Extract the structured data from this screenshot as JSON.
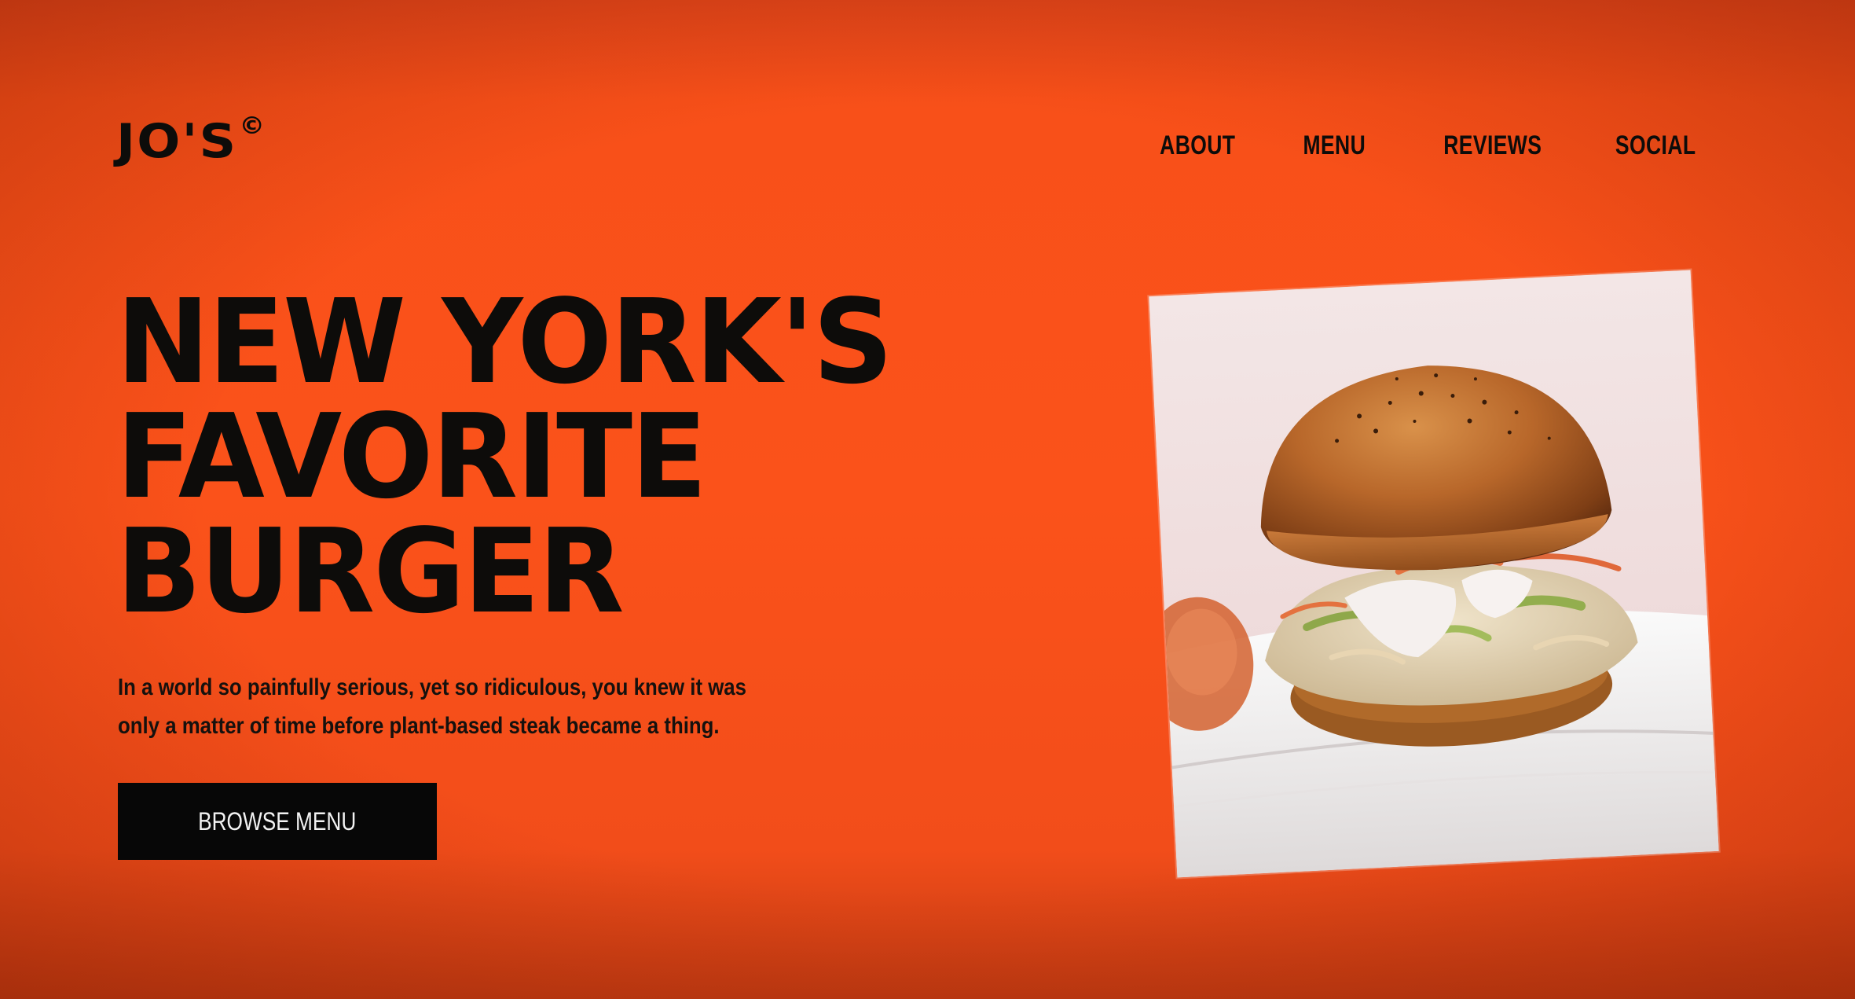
{
  "brand": {
    "name": "JO'S",
    "mark": "©"
  },
  "nav": {
    "items": [
      "ABOUT",
      "MENU",
      "REVIEWS",
      "SOCIAL"
    ]
  },
  "hero": {
    "headline_lines": [
      "NEW YORK'S",
      "FAVORITE",
      "BURGER"
    ],
    "intro_lines": [
      "In a world so painfully serious, yet so ridiculous, you knew it was",
      "only a matter of time before plant-based steak became a thing."
    ],
    "cta_label": "BROWSE MENU"
  },
  "image": {
    "subject": "burger-photo"
  },
  "colors": {
    "background": "#f8501a",
    "text": "#0d0c0a",
    "button_bg": "#070707",
    "button_text": "#f2f2f2"
  }
}
